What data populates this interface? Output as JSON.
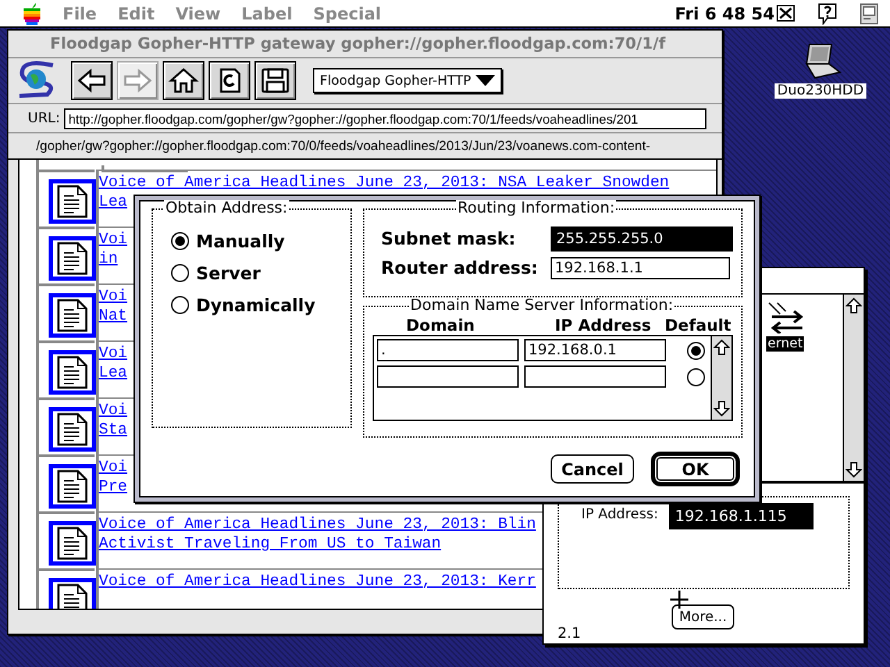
{
  "menu_bar": {
    "menus": [
      {
        "label": "File",
        "disabled": true
      },
      {
        "label": "Edit",
        "disabled": true
      },
      {
        "label": "View",
        "disabled": true
      },
      {
        "label": "Label",
        "disabled": true
      },
      {
        "label": "Special",
        "disabled": true
      }
    ],
    "clock": "Fri 6 48 54"
  },
  "browser": {
    "title": "Floodgap Gopher-HTTP gateway gopher://gopher.floodgap.com:70/1/f",
    "toolbar": [
      {
        "kind": "back",
        "disabled": false
      },
      {
        "kind": "forward",
        "disabled": true
      },
      {
        "kind": "home",
        "disabled": false
      },
      {
        "kind": "reload",
        "disabled": false
      },
      {
        "kind": "save",
        "disabled": false
      }
    ],
    "bookmark_menu": "Floodgap Gopher-HTTP",
    "url_label": "URL:",
    "url": "http://gopher.floodgap.com/gopher/gw?gopher://gopher.floodgap.com:70/1/feeds/voaheadlines/201",
    "status": "/gopher/gw?gopher://gopher.floodgap.com:70/0/feeds/voaheadlines/2013/Jun/23/voanews.com-content-",
    "items": [
      {
        "lines": [
          "Voice of America Headlines June 23, 2013: NSA Leaker Snowden",
          "Lea"
        ]
      },
      {
        "lines": [
          "Voi",
          "in"
        ]
      },
      {
        "lines": [
          "Voi",
          "Nat"
        ]
      },
      {
        "lines": [
          "Voi",
          "Lea"
        ]
      },
      {
        "lines": [
          "Voi",
          "Sta"
        ]
      },
      {
        "lines": [
          "Voi",
          "Pre"
        ]
      },
      {
        "lines": [
          "Voice of America Headlines June 23, 2013: Blin",
          "Activist Traveling From US to Taiwan"
        ]
      },
      {
        "lines": [
          "Voice of America Headlines June 23, 2013: Kerr"
        ]
      }
    ]
  },
  "tcp_window": {
    "list_label": "ernet",
    "list_label_highlighted": true,
    "ip_label": "IP Address:",
    "ip_address": "192.168.1.115",
    "ip_highlighted": true,
    "more_button": "More...",
    "version": "2.1"
  },
  "dialog": {
    "obtain_title": "Obtain Address:",
    "options": [
      {
        "label": "Manually",
        "selected": true
      },
      {
        "label": "Server",
        "selected": false
      },
      {
        "label": "Dynamically",
        "selected": false
      }
    ],
    "routing_title": "Routing Information:",
    "subnet_label": "Subnet mask:",
    "subnet_value": "255.255.255.0",
    "subnet_highlighted": true,
    "router_label": "Router address:",
    "router_value": "192.168.1.1",
    "dns_title": "Domain Name Server Information:",
    "columns": [
      "Domain",
      "IP Address",
      "Default"
    ],
    "dns_rows": [
      {
        "domain": ".",
        "ip": "192.168.0.1",
        "selected": true
      },
      {
        "selected": false
      }
    ],
    "buttons": [
      {
        "label": "Cancel",
        "default": false
      },
      {
        "label": "OK",
        "default": true
      }
    ]
  },
  "desktop_icons": [
    {
      "label": "Duo230HDD"
    }
  ]
}
